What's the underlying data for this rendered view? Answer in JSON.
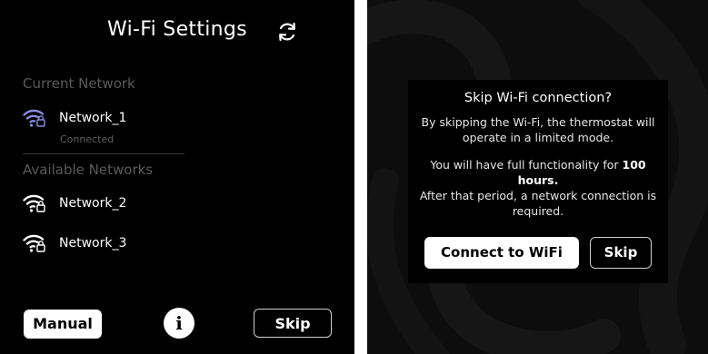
{
  "wifi_screen": {
    "title": "Wi-Fi Settings",
    "current_section": "Current Network",
    "current_network": {
      "name": "Network_1",
      "status": "Connected"
    },
    "available_section": "Available Networks",
    "available_networks": [
      {
        "name": "Network_2"
      },
      {
        "name": "Network_3"
      }
    ],
    "buttons": {
      "manual": "Manual",
      "info": "i",
      "skip": "Skip"
    }
  },
  "skip_dialog": {
    "title": "Skip Wi-Fi connection?",
    "line1": "By skipping the Wi-Fi, the thermostat will operate in a limited mode.",
    "line2_prefix": "You will have full functionality for ",
    "line2_bold": "100 hours.",
    "line3": "After that period, a network connection is required.",
    "connect_label": "Connect to WiFi",
    "skip_label": "Skip"
  },
  "colors": {
    "background": "#000000",
    "connected_wifi_icon": "#8a8fe0",
    "muted_text": "#5a5a5a"
  },
  "icons": {
    "refresh": "refresh-icon",
    "wifi_locked": "wifi-lock-icon"
  }
}
